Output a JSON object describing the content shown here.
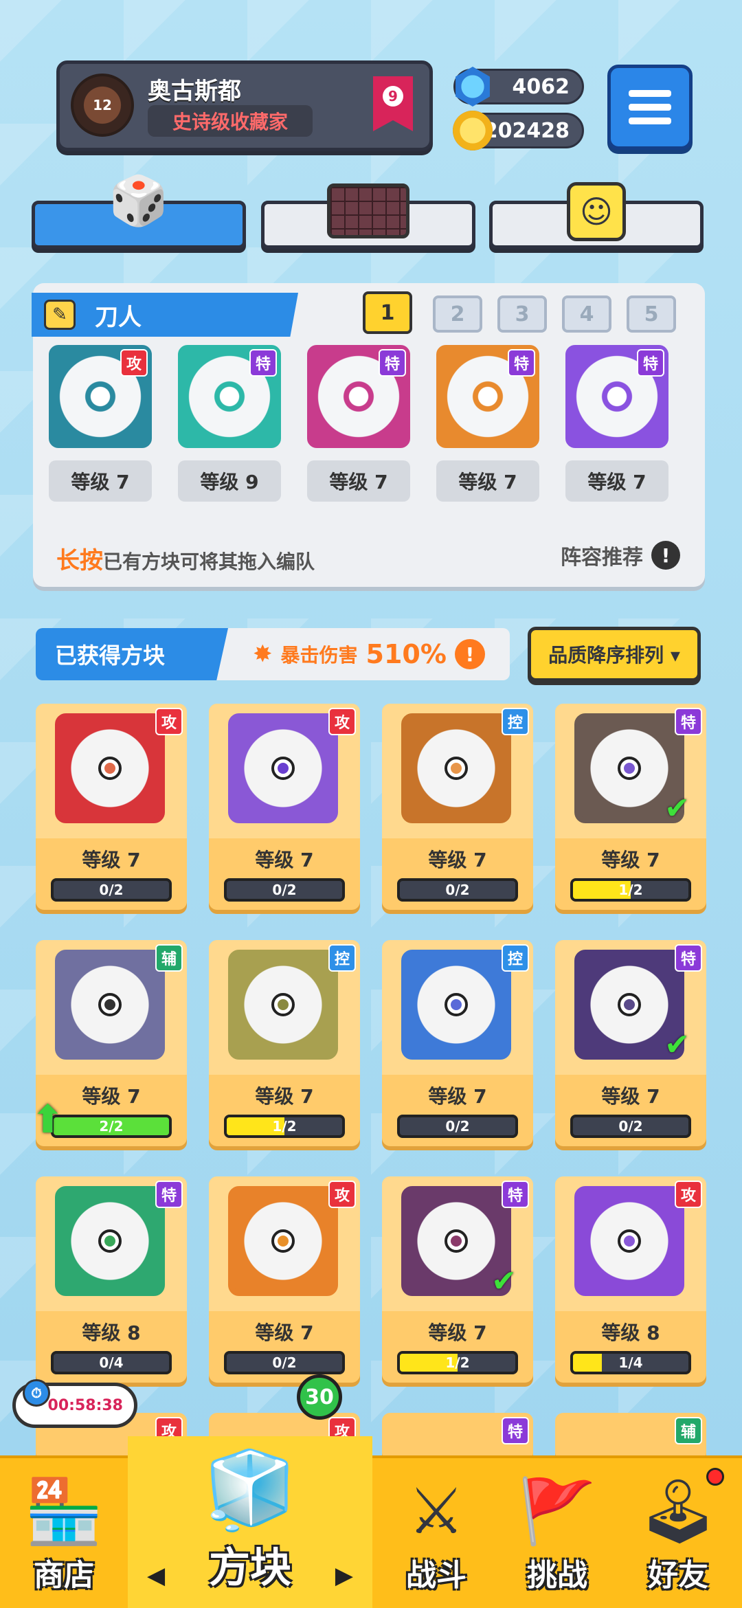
{
  "profile": {
    "name": "奥古斯都",
    "title": "史诗级收藏家",
    "avatar_level": "12",
    "rank": "9"
  },
  "currency": {
    "gems": "4062",
    "coins": "202428"
  },
  "category_tabs": [
    {
      "icon": "dice-icon",
      "active": true
    },
    {
      "icon": "grid-board-icon",
      "active": false
    },
    {
      "icon": "smiley-block-icon",
      "active": false
    }
  ],
  "deck": {
    "title": "刀人",
    "tabs": [
      "1",
      "2",
      "3",
      "4",
      "5"
    ],
    "active_tab": "1",
    "slots": [
      {
        "tag": "攻",
        "tag_color": "#e9313d",
        "level": "等级 7",
        "color": "#2a8aa0"
      },
      {
        "tag": "特",
        "tag_color": "#8b3ad8",
        "level": "等级 9",
        "color": "#2db8a8"
      },
      {
        "tag": "特",
        "tag_color": "#8b3ad8",
        "level": "等级 7",
        "color": "#c83c8c"
      },
      {
        "tag": "特",
        "tag_color": "#8b3ad8",
        "level": "等级 7",
        "color": "#e88a2e"
      },
      {
        "tag": "特",
        "tag_color": "#8b3ad8",
        "level": "等级 7",
        "color": "#8a52e0"
      }
    ],
    "hint_emphasis": "长按",
    "hint_text": "已有方块可将其拖入编队",
    "recommend_label": "阵容推荐",
    "recommend_icon": "!"
  },
  "obtained": {
    "title": "已获得方块",
    "crit_label": "暴击伤害",
    "crit_value": "510%",
    "crit_icon": "!",
    "sort_label": "品质降序排列 ▾"
  },
  "cards": [
    {
      "tag": "攻",
      "tag_color": "#e9313d",
      "level": "等级 7",
      "progress": "0/2",
      "fill": 0,
      "color": "#d8353a",
      "core": "#e06a4a",
      "check": false
    },
    {
      "tag": "攻",
      "tag_color": "#e9313d",
      "level": "等级 7",
      "progress": "0/2",
      "fill": 0,
      "color": "#8a58d6",
      "core": "#6a3fd0",
      "check": false
    },
    {
      "tag": "控",
      "tag_color": "#2e90e8",
      "level": "等级 7",
      "progress": "0/2",
      "fill": 0,
      "color": "#c8742a",
      "core": "#e8964a",
      "check": false
    },
    {
      "tag": "特",
      "tag_color": "#8b3ad8",
      "level": "等级 7",
      "progress": "1/2",
      "fill": 0.5,
      "color": "#6b5a52",
      "core": "#7a58d0",
      "check": true
    },
    {
      "tag": "辅",
      "tag_color": "#22a86a",
      "level": "等级 7",
      "progress": "2/2",
      "fill": 1,
      "color": "#7070a0",
      "core": "#333",
      "check": false,
      "upgrade": true
    },
    {
      "tag": "控",
      "tag_color": "#2e90e8",
      "level": "等级 7",
      "progress": "1/2",
      "fill": 0.5,
      "color": "#a8a050",
      "core": "#8a8a40",
      "check": false
    },
    {
      "tag": "控",
      "tag_color": "#2e90e8",
      "level": "等级 7",
      "progress": "0/2",
      "fill": 0,
      "color": "#3e7ad8",
      "core": "#5a6ad8",
      "check": false
    },
    {
      "tag": "特",
      "tag_color": "#8b3ad8",
      "level": "等级 7",
      "progress": "0/2",
      "fill": 0,
      "color": "#4e3a7a",
      "core": "#5a4a8a",
      "check": true
    },
    {
      "tag": "特",
      "tag_color": "#8b3ad8",
      "level": "等级 8",
      "progress": "0/4",
      "fill": 0,
      "color": "#2ea870",
      "core": "#3aa85a",
      "check": false
    },
    {
      "tag": "攻",
      "tag_color": "#e9313d",
      "level": "等级 7",
      "progress": "0/2",
      "fill": 0,
      "color": "#e8822a",
      "core": "#e8902a",
      "check": false
    },
    {
      "tag": "特",
      "tag_color": "#8b3ad8",
      "level": "等级 7",
      "progress": "1/2",
      "fill": 0.5,
      "color": "#6a3a6a",
      "core": "#8a3a6a",
      "check": true
    },
    {
      "tag": "攻",
      "tag_color": "#e9313d",
      "level": "等级 8",
      "progress": "1/4",
      "fill": 0.25,
      "color": "#8a4ad8",
      "core": "#8a5ad8",
      "check": false
    }
  ],
  "partial_row_tags": [
    {
      "tag": "攻",
      "tag_color": "#e9313d"
    },
    {
      "tag": "攻",
      "tag_color": "#e9313d"
    },
    {
      "tag": "特",
      "tag_color": "#8b3ad8"
    },
    {
      "tag": "辅",
      "tag_color": "#22a86a"
    }
  ],
  "timer": "00:58:38",
  "nav": {
    "items": [
      {
        "label": "商店",
        "icon": "shop-icon"
      },
      {
        "label": "方块",
        "icon": "mystery-cube-icon",
        "active": true,
        "badge": "30"
      },
      {
        "label": "战斗",
        "icon": "battle-icon"
      },
      {
        "label": "挑战",
        "icon": "challenge-icon"
      },
      {
        "label": "好友",
        "icon": "friends-icon",
        "dot": true
      }
    ]
  }
}
